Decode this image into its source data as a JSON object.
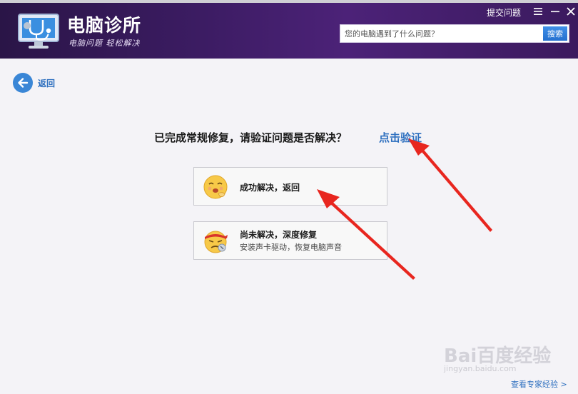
{
  "header": {
    "app_title": "电脑诊所",
    "slogan": "电脑问题 轻松解决",
    "submit_link": "提交问题",
    "search": {
      "placeholder": "您的电脑遇到了什么问题？",
      "button_label": "搜索"
    }
  },
  "nav": {
    "back_label": "返回"
  },
  "main": {
    "question": "已完成常规修复，请验证问题是否解决？",
    "verify_link": "点击验证",
    "options": [
      {
        "title": "成功解决，返回",
        "subtitle": ""
      },
      {
        "title": "尚未解决，深度修复",
        "subtitle": "安装声卡驱动，恢复电脑声音"
      }
    ]
  },
  "watermark": {
    "brand": "Bai百度经验",
    "url": "jingyan.baidu.com"
  },
  "footer": {
    "expert_link": "查看专家经验 >"
  },
  "colors": {
    "header_bg": "#3c1c63",
    "link_blue": "#2d6fbf",
    "annotation_red": "#e8261f"
  }
}
